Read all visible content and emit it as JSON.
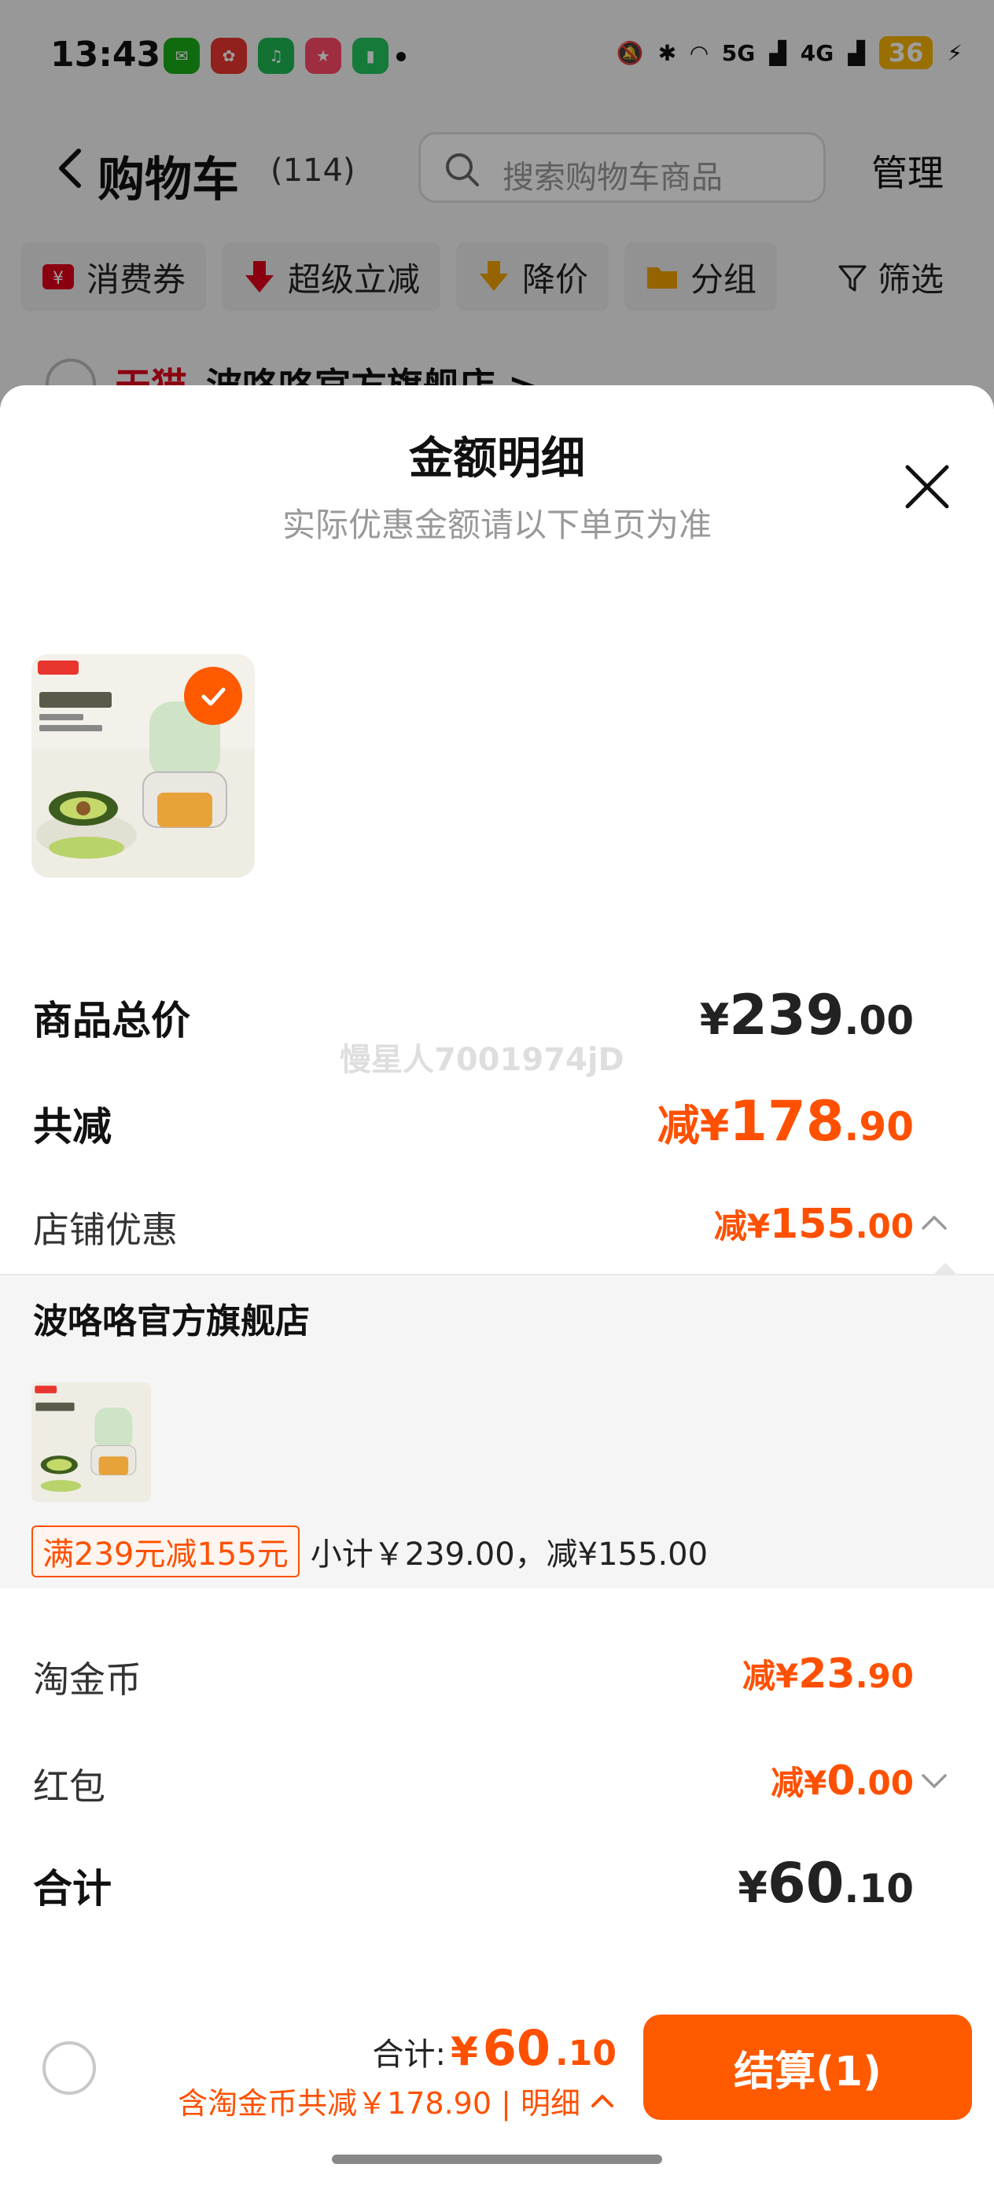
{
  "status_bar": {
    "time": "13:43",
    "battery": "36",
    "signal_5g": "5G",
    "signal_4g": "4G"
  },
  "nav": {
    "title": "购物车",
    "count": "(114)",
    "search_placeholder": "搜索购物车商品",
    "manage": "管理"
  },
  "chips": [
    {
      "label": "消费券",
      "icon": "coupon-icon",
      "color": "#e0001b"
    },
    {
      "label": "超级立减",
      "icon": "arrow-down-icon",
      "color": "#e0001b"
    },
    {
      "label": "降价",
      "icon": "price-drop-icon",
      "color": "#f0a000"
    },
    {
      "label": "分组",
      "icon": "folder-icon",
      "color": "#f0a000"
    }
  ],
  "filter": {
    "label": "筛选"
  },
  "store_peek": {
    "brand": "天猫",
    "name": "波咯咯官方旗舰店 >"
  },
  "sheet": {
    "title": "金额明细",
    "subtitle": "实际优惠金额请以下单页为准",
    "rows": {
      "goods_total": {
        "label": "商品总价",
        "symbol": "¥",
        "int": "239",
        "dec": ".00"
      },
      "total_reduce": {
        "label": "共减",
        "prefix": "减¥",
        "int": "178",
        "dec": ".90"
      },
      "store_discount": {
        "label": "店铺优惠",
        "prefix": "减¥",
        "int": "155",
        "dec": ".00"
      },
      "tao_coin": {
        "label": "淘金币",
        "prefix": "减¥",
        "int": "23",
        "dec": ".90"
      },
      "red_packet": {
        "label": "红包",
        "prefix": "减¥",
        "int": "0",
        "dec": ".00"
      },
      "sum": {
        "label": "合计",
        "symbol": "¥",
        "int": "60",
        "dec": ".10"
      }
    },
    "store_panel": {
      "name": "波咯咯官方旗舰店",
      "promo_tag": "满239元减155元",
      "promo_sub": "小计￥239.00，减¥155.00"
    },
    "watermark": "慢星人7001974jD"
  },
  "bottom_bar": {
    "total_label": "合计:",
    "total_symbol": "¥",
    "total_int": "60",
    "total_dec": ".10",
    "saving": "含淘金币共减￥178.90 | 明细",
    "checkout": "结算(1)"
  },
  "colors": {
    "accent": "#ff5000",
    "button": "#ff5a00",
    "tmall": "#e0001b"
  }
}
